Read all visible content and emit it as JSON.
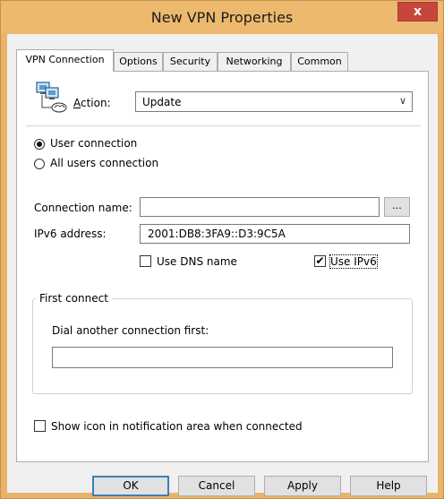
{
  "window": {
    "title": "New VPN Properties",
    "close_glyph": "x"
  },
  "tabs": [
    {
      "label": "VPN Connection",
      "active": true
    },
    {
      "label": "Options",
      "active": false
    },
    {
      "label": "Security",
      "active": false
    },
    {
      "label": "Networking",
      "active": false
    },
    {
      "label": "Common",
      "active": false
    }
  ],
  "action": {
    "label": "Action:",
    "selected": "Update",
    "icon": "network-computers-icon"
  },
  "scope": {
    "user_connection": {
      "label": "User connection",
      "checked": true
    },
    "all_users_connection": {
      "label": "All users connection",
      "checked": false
    }
  },
  "connection_name": {
    "label": "Connection name:",
    "value": "",
    "browse_label": "..."
  },
  "ipv6_address": {
    "label": "IPv6 address:",
    "value": "2001:DB8:3FA9::D3:9C5A"
  },
  "use_dns_name": {
    "label": "Use DNS name",
    "checked": false
  },
  "use_ipv6": {
    "label": "Use IPv6",
    "checked": true,
    "mark": "✔"
  },
  "first_connect": {
    "title": "First connect",
    "dial_label": "Dial another connection first:",
    "dial_value": ""
  },
  "show_icon": {
    "label": "Show icon in notification area when connected",
    "checked": false
  },
  "buttons": {
    "ok": "OK",
    "cancel": "Cancel",
    "apply": "Apply",
    "help": "Help"
  },
  "colors": {
    "title_bar": "#edb96f",
    "close_button": "#c7463c",
    "default_button_border": "#3c7fb1"
  }
}
